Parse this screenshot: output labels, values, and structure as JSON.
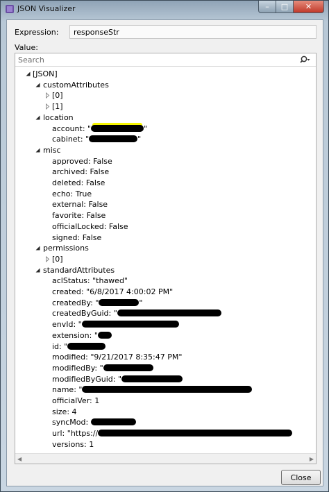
{
  "window": {
    "title": "JSON Visualizer",
    "min_glyph": "–",
    "max_glyph": "□",
    "close_glyph": "✕"
  },
  "expression": {
    "label": "Expression:",
    "value": "responseStr"
  },
  "value_label": "Value:",
  "search": {
    "placeholder": "Search",
    "value": ""
  },
  "tree": [
    {
      "text": "[JSON]",
      "level": 0,
      "state": "expanded"
    },
    {
      "text": "customAttributes",
      "level": 1,
      "state": "expanded"
    },
    {
      "text": "[0]",
      "level": 2,
      "state": "collapsed"
    },
    {
      "text": "[1]",
      "level": 2,
      "state": "collapsed"
    },
    {
      "text": "location",
      "level": 1,
      "state": "expanded"
    },
    {
      "text": "account: \"",
      "level": 2,
      "state": "leaf",
      "redacted": true,
      "suffix": "\""
    },
    {
      "text": "cabinet: \"",
      "level": 2,
      "state": "leaf",
      "redacted": true,
      "suffix": "\""
    },
    {
      "text": "misc",
      "level": 1,
      "state": "expanded"
    },
    {
      "text": "approved: False",
      "level": 2,
      "state": "leaf"
    },
    {
      "text": "archived: False",
      "level": 2,
      "state": "leaf"
    },
    {
      "text": "deleted: False",
      "level": 2,
      "state": "leaf"
    },
    {
      "text": "echo: True",
      "level": 2,
      "state": "leaf"
    },
    {
      "text": "external: False",
      "level": 2,
      "state": "leaf"
    },
    {
      "text": "favorite: False",
      "level": 2,
      "state": "leaf"
    },
    {
      "text": "officialLocked: False",
      "level": 2,
      "state": "leaf"
    },
    {
      "text": "signed: False",
      "level": 2,
      "state": "leaf"
    },
    {
      "text": "permissions",
      "level": 1,
      "state": "expanded"
    },
    {
      "text": "[0]",
      "level": 2,
      "state": "collapsed"
    },
    {
      "text": "standardAttributes",
      "level": 1,
      "state": "expanded"
    },
    {
      "text": "aclStatus: \"thawed\"",
      "level": 2,
      "state": "leaf"
    },
    {
      "text": "created: \"6/8/2017 4:00:02 PM\"",
      "level": 2,
      "state": "leaf"
    },
    {
      "text": "createdBy: \"",
      "level": 2,
      "state": "leaf",
      "redacted": true,
      "suffix": "\""
    },
    {
      "text": "createdByGuid: \"",
      "level": 2,
      "state": "leaf",
      "redacted": true,
      "suffix": ""
    },
    {
      "text": "envId: \"",
      "level": 2,
      "state": "leaf",
      "redacted": true,
      "suffix": ""
    },
    {
      "text": "extension: \"",
      "level": 2,
      "state": "leaf",
      "redacted": true,
      "suffix": ""
    },
    {
      "text": "id: \"",
      "level": 2,
      "state": "leaf",
      "redacted": true,
      "suffix": ""
    },
    {
      "text": "modified: \"9/21/2017 8:35:47 PM\"",
      "level": 2,
      "state": "leaf"
    },
    {
      "text": "modifiedBy: \"",
      "level": 2,
      "state": "leaf",
      "redacted": true,
      "suffix": ""
    },
    {
      "text": "modifiedByGuid: \"",
      "level": 2,
      "state": "leaf",
      "redacted": true,
      "suffix": ""
    },
    {
      "text": "name: \"",
      "level": 2,
      "state": "leaf",
      "redacted": true,
      "suffix": ""
    },
    {
      "text": "officialVer: 1",
      "level": 2,
      "state": "leaf"
    },
    {
      "text": "size: 4",
      "level": 2,
      "state": "leaf"
    },
    {
      "text": "syncMod: ",
      "level": 2,
      "state": "leaf",
      "redacted": true,
      "suffix": ""
    },
    {
      "text": "url: \"https://",
      "level": 2,
      "state": "leaf",
      "redacted": true,
      "suffix": ""
    },
    {
      "text": "versions: 1",
      "level": 2,
      "state": "leaf"
    }
  ],
  "buttons": {
    "close_label": "Close"
  },
  "colors": {
    "highlight": "#f5f500",
    "redaction": "#000000",
    "titlebar": "#8fa3b6"
  }
}
